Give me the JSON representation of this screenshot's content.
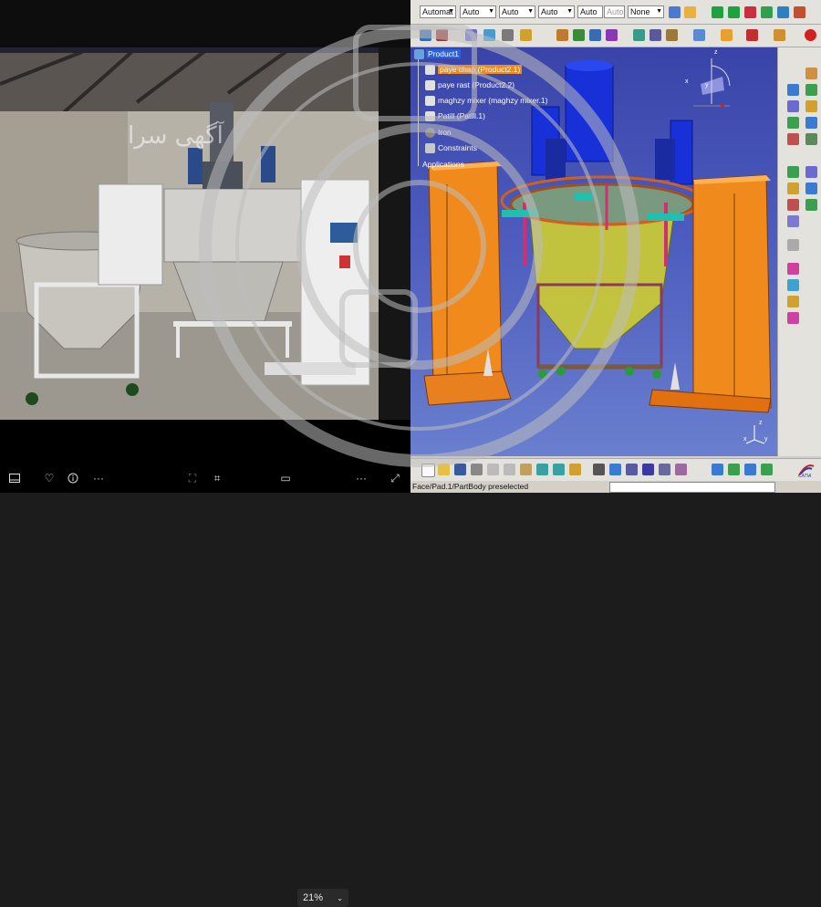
{
  "viewer": {
    "photo_watermark": "آگهی سرا",
    "zoom": "21%"
  },
  "catia": {
    "toolbar_selects": [
      "Automat",
      "Auto",
      "Auto",
      "Auto",
      "Auto",
      "Auto",
      "None"
    ],
    "tree": {
      "root": "Product1",
      "items": [
        "paye chap (Product2.1)",
        "paye rast (Product2.2)",
        "maghzy mixer (maghzy mixer.1)",
        "Patill (Patill.1)",
        "Iron",
        "Constraints",
        "Applications"
      ]
    },
    "compass": {
      "x": "x",
      "y": "y",
      "z": "z"
    },
    "axis": {
      "x": "x",
      "y": "y",
      "z": "z"
    },
    "status_text": "Face/Pad.1/PartBody preselected",
    "brand": "CATIA",
    "colors": {
      "background": "#4c5bbd",
      "highlight": "#f08a1c",
      "selection": "#2a62d8"
    }
  }
}
